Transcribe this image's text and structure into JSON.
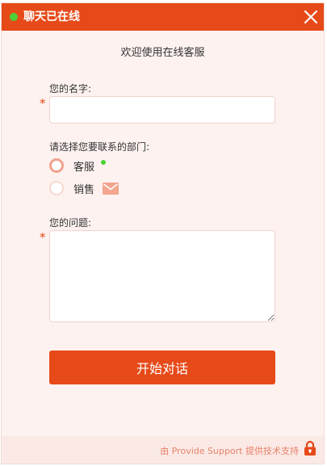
{
  "window": {
    "title": "聊天已在线",
    "status": "online",
    "colors": {
      "accent": "#e64a19",
      "online": "#4cd137",
      "background": "#fdf2f0"
    }
  },
  "welcome_text": "欢迎使用在线客服",
  "form": {
    "name": {
      "label": "您的名字:",
      "value": "",
      "required_mark": "*"
    },
    "department": {
      "label": "请选择您要联系的部门:",
      "options": [
        {
          "label": "客服",
          "selected": true,
          "indicator": "online-dot"
        },
        {
          "label": "销售",
          "selected": false,
          "indicator": "mail-icon"
        }
      ]
    },
    "question": {
      "label": "您的问题:",
      "value": "",
      "required_mark": "*"
    },
    "submit_label": "开始对话"
  },
  "footer": {
    "text": "由 Provide Support 提供技术支持",
    "icon": "lock-icon"
  }
}
